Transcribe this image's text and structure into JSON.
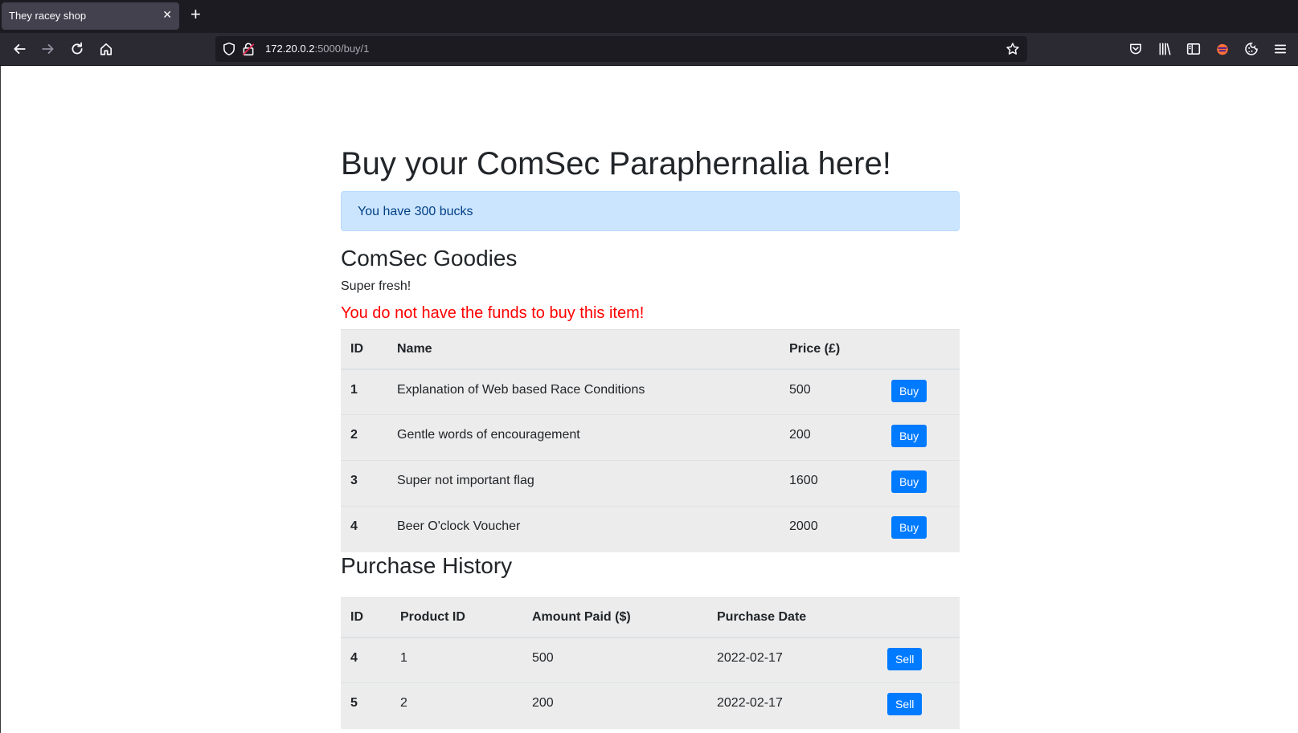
{
  "browser": {
    "tab_title": "They racey shop",
    "tab_close_glyph": "✕",
    "new_tab_glyph": "+",
    "url_host": "172.20.0.2",
    "url_rest": ":5000/buy/1"
  },
  "page": {
    "title": "Buy your ComSec Paraphernalia here!",
    "balance_alert": "You have 300 bucks",
    "goodies_heading": "ComSec Goodies",
    "goodies_subtitle": "Super fresh!",
    "error_message": "You do not have the funds to buy this item!",
    "history_heading": "Purchase History"
  },
  "products": {
    "headers": {
      "id": "ID",
      "name": "Name",
      "price": "Price (£)"
    },
    "rows": [
      {
        "id": "1",
        "name": "Explanation of Web based Race Conditions",
        "price": "500",
        "action": "Buy"
      },
      {
        "id": "2",
        "name": "Gentle words of encouragement",
        "price": "200",
        "action": "Buy"
      },
      {
        "id": "3",
        "name": "Super not important flag",
        "price": "1600",
        "action": "Buy"
      },
      {
        "id": "4",
        "name": "Beer O'clock Voucher",
        "price": "2000",
        "action": "Buy"
      }
    ]
  },
  "history": {
    "headers": {
      "id": "ID",
      "product_id": "Product ID",
      "amount": "Amount Paid ($)",
      "date": "Purchase Date"
    },
    "rows": [
      {
        "id": "4",
        "product_id": "1",
        "amount": "500",
        "date": "2022-02-17",
        "action": "Sell"
      },
      {
        "id": "5",
        "product_id": "2",
        "amount": "200",
        "date": "2022-02-17",
        "action": "Sell"
      }
    ]
  },
  "colors": {
    "accent": "#007bff",
    "alert_bg": "#cce5ff",
    "error": "#ff0000"
  },
  "icons": [
    "back-arrow-icon",
    "forward-arrow-icon",
    "reload-icon",
    "home-icon",
    "shield-icon",
    "lock-icon",
    "star-icon",
    "pocket-icon",
    "library-icon",
    "sidebar-icon",
    "extension-icon",
    "cookie-icon",
    "menu-icon"
  ]
}
